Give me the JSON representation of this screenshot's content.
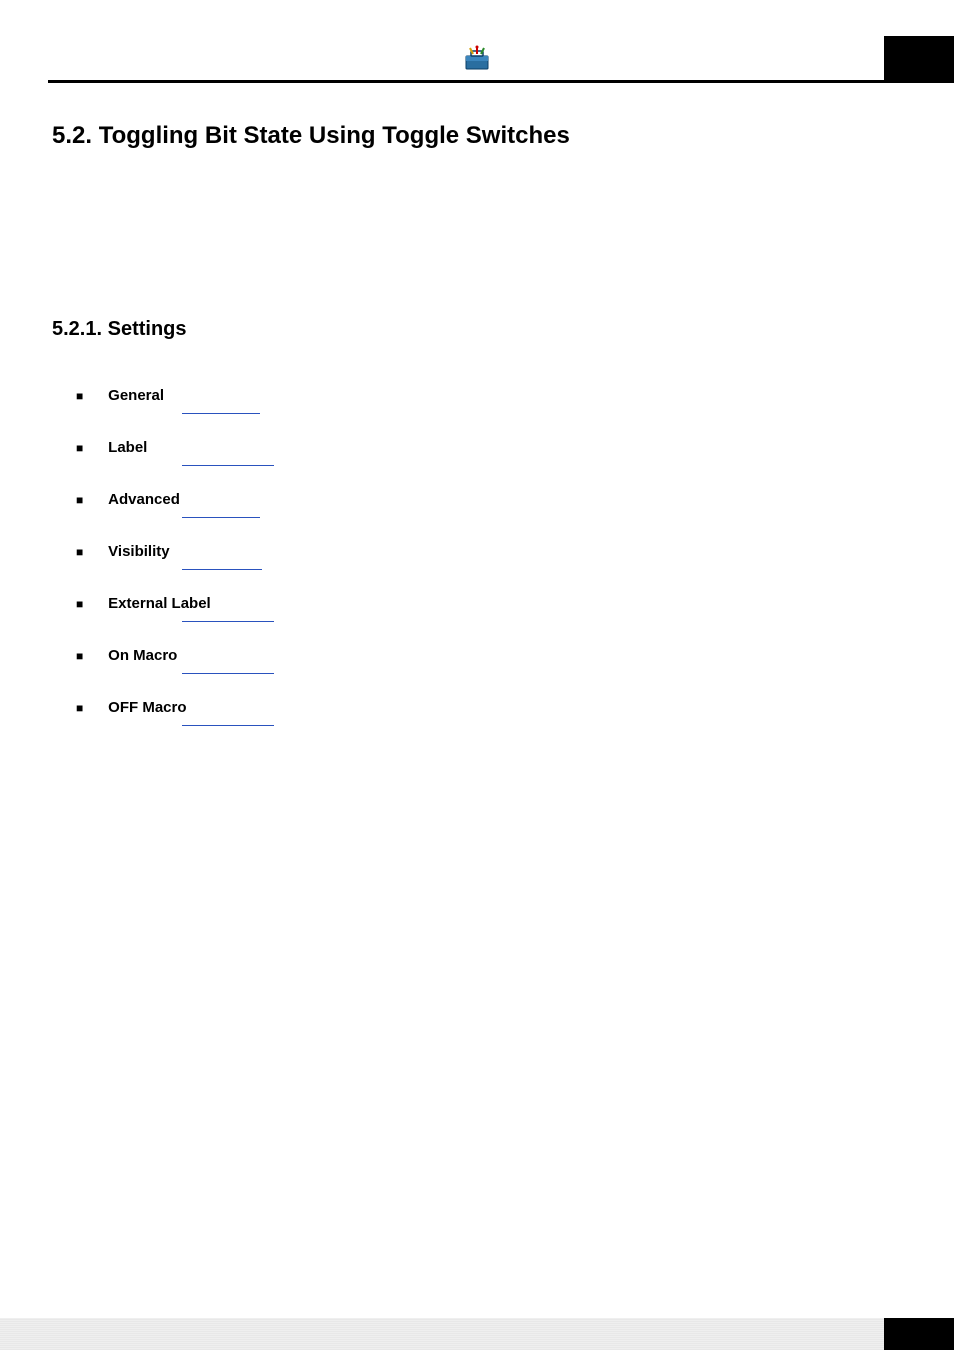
{
  "section": {
    "number": "5.2.",
    "title": "Toggling Bit State Using Toggle Switches"
  },
  "subsection": {
    "number": "5.2.1.",
    "title": "Settings"
  },
  "settings_items": [
    {
      "label": "General"
    },
    {
      "label": "Label"
    },
    {
      "label": "Advanced"
    },
    {
      "label": "Visibility"
    },
    {
      "label": "External Label"
    },
    {
      "label": "On Macro"
    },
    {
      "label": "OFF Macro"
    }
  ],
  "icons": {
    "header": "toolbox-icon"
  }
}
